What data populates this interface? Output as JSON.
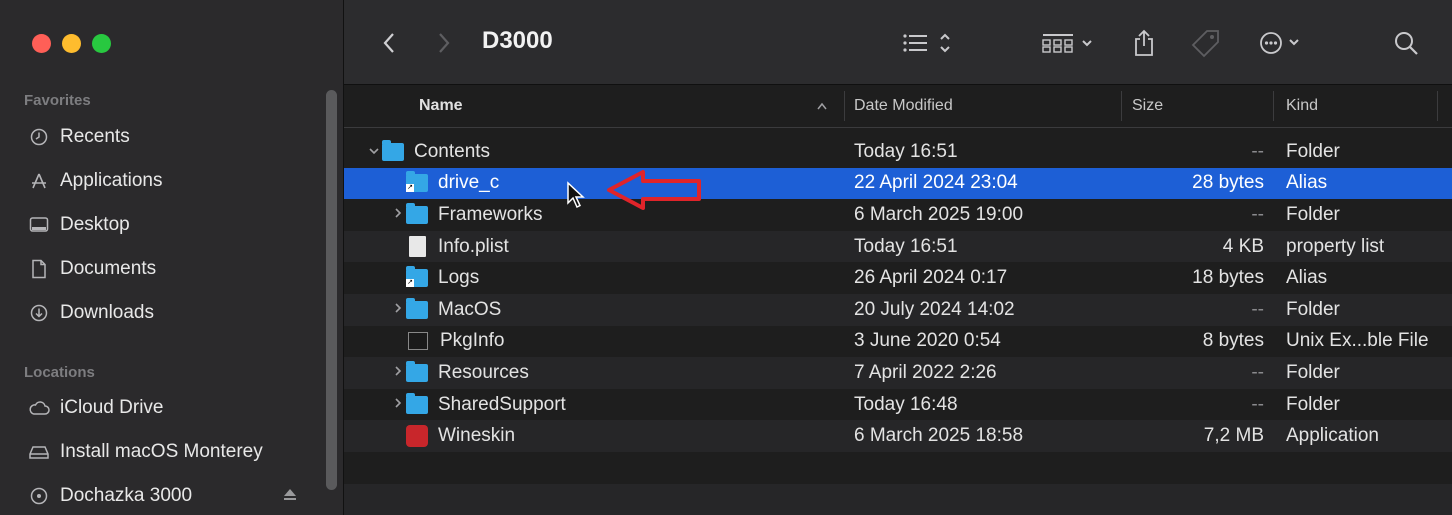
{
  "sidebar": {
    "favorites_title": "Favorites",
    "favorites": [
      {
        "label": "Recents",
        "icon": "clock-icon"
      },
      {
        "label": "Applications",
        "icon": "applications-icon"
      },
      {
        "label": "Desktop",
        "icon": "desktop-icon"
      },
      {
        "label": "Documents",
        "icon": "document-icon"
      },
      {
        "label": "Downloads",
        "icon": "download-icon"
      }
    ],
    "locations_title": "Locations",
    "locations": [
      {
        "label": "iCloud Drive",
        "icon": "cloud-icon"
      },
      {
        "label": "Install macOS Monterey",
        "icon": "disk-icon"
      },
      {
        "label": "Dochazka 3000",
        "icon": "disc-icon"
      }
    ]
  },
  "toolbar": {
    "title": "D3000"
  },
  "columns": {
    "name": "Name",
    "date": "Date Modified",
    "size": "Size",
    "kind": "Kind"
  },
  "rows": [
    {
      "name": "Contents",
      "date": "Today 16:51",
      "size": "--",
      "kind": "Folder",
      "type": "folder",
      "expanded": true
    },
    {
      "name": "drive_c",
      "date": "22 April 2024 23:04",
      "size": "28 bytes",
      "kind": "Alias",
      "type": "alias",
      "selected": true
    },
    {
      "name": "Frameworks",
      "date": "6 March 2025 19:00",
      "size": "--",
      "kind": "Folder",
      "type": "folder"
    },
    {
      "name": "Info.plist",
      "date": "Today 16:51",
      "size": "4 KB",
      "kind": "property list",
      "type": "document"
    },
    {
      "name": "Logs",
      "date": "26 April 2024 0:17",
      "size": "18 bytes",
      "kind": "Alias",
      "type": "alias"
    },
    {
      "name": "MacOS",
      "date": "20 July 2024 14:02",
      "size": "--",
      "kind": "Folder",
      "type": "folder"
    },
    {
      "name": "PkgInfo",
      "date": "3 June 2020 0:54",
      "size": "8 bytes",
      "kind": "Unix Ex...ble File",
      "type": "exec"
    },
    {
      "name": "Resources",
      "date": "7 April 2022 2:26",
      "size": "--",
      "kind": "Folder",
      "type": "folder"
    },
    {
      "name": "SharedSupport",
      "date": "Today 16:48",
      "size": "--",
      "kind": "Folder",
      "type": "folder"
    },
    {
      "name": "Wineskin",
      "date": "6 March 2025 18:58",
      "size": "7,2 MB",
      "kind": "Application",
      "type": "app"
    }
  ],
  "colors": {
    "selection": "#1d5fd6",
    "folder": "#34a7e6",
    "annotation_arrow": "#e0242a"
  }
}
